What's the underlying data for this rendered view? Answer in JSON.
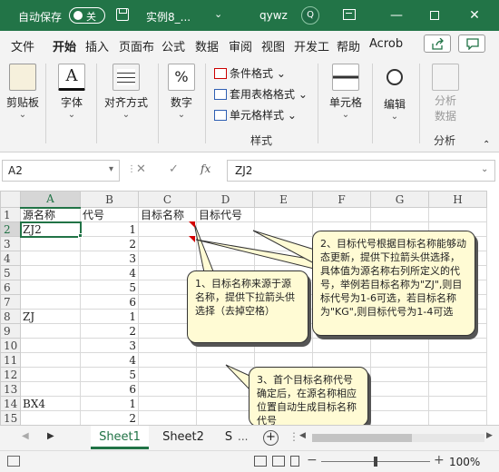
{
  "titlebar": {
    "autosave_label": "自动保存",
    "autosave_state": "关",
    "filename": "实例8_...",
    "dropdown": "⌄",
    "username": "qywz",
    "avatar_initial": "Q",
    "accent_color": "#227447"
  },
  "menu": {
    "tabs": [
      "文件",
      "开始",
      "插入",
      "页面布",
      "公式",
      "数据",
      "审阅",
      "视图",
      "开发工",
      "帮助",
      "Acrob"
    ],
    "active_tab": "开始"
  },
  "ribbon": {
    "clipboard": "剪贴板",
    "font": "字体",
    "alignment": "对齐方式",
    "number": "数字",
    "number_icon": "%",
    "conditional_format": "条件格式 ⌄",
    "table_format": "套用表格格式 ⌄",
    "cell_style": "单元格样式 ⌄",
    "styles_group": "样式",
    "cells": "单元格",
    "editing": "编辑",
    "analyze_data_line1": "分析",
    "analyze_data_line2": "数据",
    "analysis_group": "分析",
    "caret": "⌄",
    "font_icon_letter": "A"
  },
  "formula_bar": {
    "name_box": "A2",
    "formula": "ZJ2",
    "fx": "fx",
    "cancel": "✕",
    "confirm": "✓"
  },
  "grid": {
    "columns": [
      "A",
      "B",
      "C",
      "D",
      "E",
      "F",
      "G",
      "H"
    ],
    "rows": [
      {
        "n": "1",
        "a": "源名称",
        "b": "代号",
        "c": "目标名称",
        "d": "目标代号"
      },
      {
        "n": "2",
        "a": "ZJ2",
        "b": "1",
        "c": "",
        "d": ""
      },
      {
        "n": "3",
        "a": "",
        "b": "2",
        "c": "",
        "d": ""
      },
      {
        "n": "4",
        "a": "",
        "b": "3",
        "c": "",
        "d": ""
      },
      {
        "n": "5",
        "a": "",
        "b": "4",
        "c": "",
        "d": ""
      },
      {
        "n": "6",
        "a": "",
        "b": "5",
        "c": "",
        "d": ""
      },
      {
        "n": "7",
        "a": "",
        "b": "6",
        "c": "",
        "d": ""
      },
      {
        "n": "8",
        "a": "ZJ",
        "b": "1",
        "c": "",
        "d": ""
      },
      {
        "n": "9",
        "a": "",
        "b": "2",
        "c": "",
        "d": ""
      },
      {
        "n": "10",
        "a": "",
        "b": "3",
        "c": "",
        "d": ""
      },
      {
        "n": "11",
        "a": "",
        "b": "4",
        "c": "",
        "d": ""
      },
      {
        "n": "12",
        "a": "",
        "b": "5",
        "c": "",
        "d": ""
      },
      {
        "n": "13",
        "a": "",
        "b": "6",
        "c": "",
        "d": ""
      },
      {
        "n": "14",
        "a": "BX4",
        "b": "1",
        "c": "",
        "d": ""
      },
      {
        "n": "15",
        "a": "",
        "b": "2",
        "c": "",
        "d": ""
      }
    ]
  },
  "callouts": {
    "one": "1、目标名称来源于源名称，提供下拉箭头供选择（去掉空格）",
    "two": "2、目标代号根据目标名称能够动态更新，提供下拉箭头供选择，具体值为源名称右列所定义的代号，举例若目标名称为\"ZJ\",则目标代号为1-6可选，若目标名称为\"KG\",则目标代号为1-4可选",
    "three": "3、首个目标名称代号确定后，在源名称相应位置自动生成目标名称代号"
  },
  "sheet_tabs": {
    "tabs": [
      "Sheet1",
      "Sheet2",
      "S"
    ],
    "active": "Sheet1",
    "ellipsis": "...",
    "add": "+"
  },
  "status": {
    "zoom": "100%",
    "minus": "−",
    "plus": "+"
  }
}
